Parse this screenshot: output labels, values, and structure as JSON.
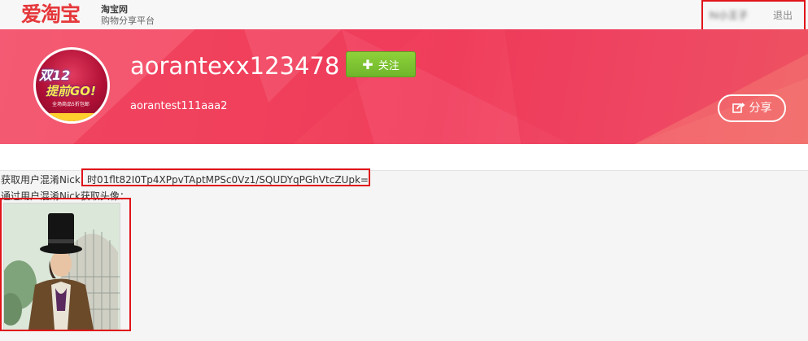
{
  "topbar": {
    "logo": "爱淘宝",
    "logo_sub1": "淘宝网",
    "logo_sub2": "购物分享平台",
    "user": "hi小王子",
    "logout": "退出"
  },
  "profile": {
    "avatar_text1": "双12",
    "avatar_text2": "提前GO!",
    "avatar_text3": "全场商品5折包邮",
    "username": "aorantexx123478",
    "follow_label": "关注",
    "nickname": "aorantest111aaa2",
    "share_label": "分享"
  },
  "content": {
    "nick_label": "获取用户混淆Nick",
    "nick_value": "时01flt82I0Tp4XPpvTAptMPSc0Vz1/SQUDYqPGhVtcZUpk=",
    "avatar_label": "通过用户混淆Nick获取头像："
  },
  "colors": {
    "brand_red": "#e5383b",
    "banner": "#f2475e",
    "follow_green": "#78c12f",
    "highlight_box": "#e0141a"
  },
  "icons": [
    "plus-icon",
    "share-icon"
  ]
}
